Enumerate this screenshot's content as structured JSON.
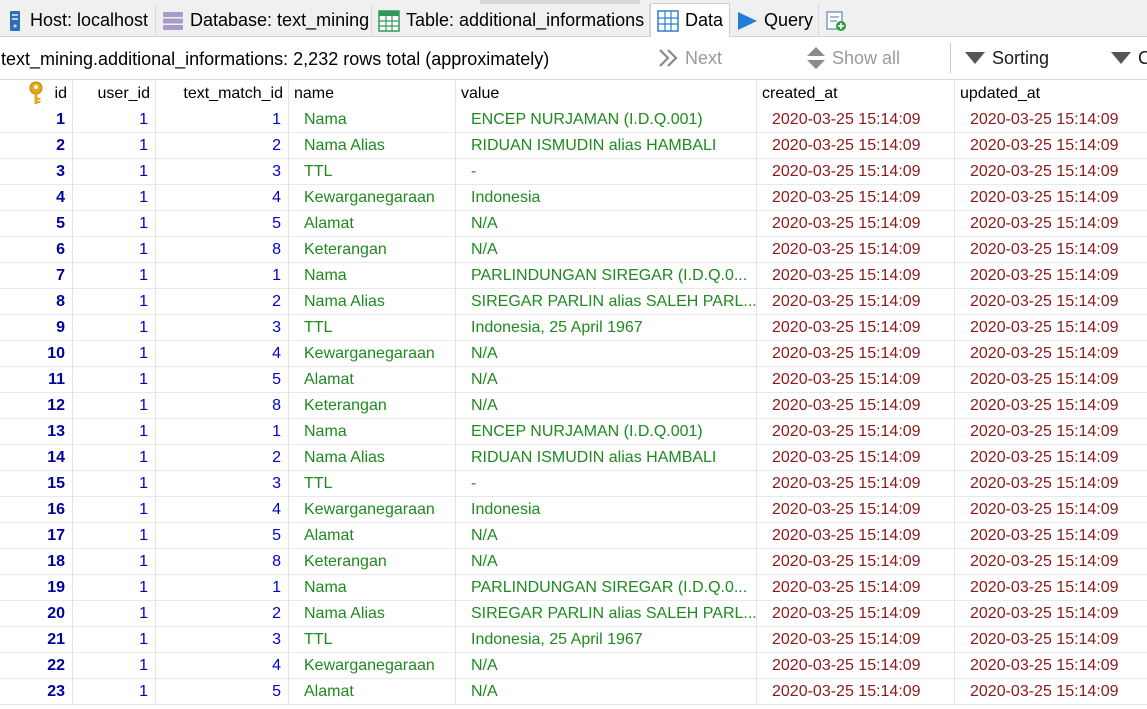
{
  "tabs": [
    {
      "label": "Host: localhost",
      "icon": "server-icon"
    },
    {
      "label": "Database: text_mining",
      "icon": "database-icon"
    },
    {
      "label": "Table: additional_informations",
      "icon": "table-icon"
    },
    {
      "label": "Data",
      "icon": "data-grid-icon",
      "active": true
    },
    {
      "label": "Query",
      "icon": "play-icon"
    },
    {
      "label": "",
      "icon": "new-query-icon"
    }
  ],
  "toolbar": {
    "status": "text_mining.additional_informations: 2,232 rows total (approximately)",
    "next_label": "Next",
    "show_all_label": "Show all",
    "sorting_label": "Sorting",
    "filter_label": "C"
  },
  "columns": [
    "id",
    "user_id",
    "text_match_id",
    "name",
    "value",
    "created_at",
    "updated_at"
  ],
  "primary_key_icon": "key-icon",
  "rows": [
    {
      "id": "1",
      "user_id": "1",
      "text_match_id": "1",
      "name": "Nama",
      "value": "ENCEP NURJAMAN (I.D.Q.001)",
      "created_at": "2020-03-25 15:14:09",
      "updated_at": "2020-03-25 15:14:09"
    },
    {
      "id": "2",
      "user_id": "1",
      "text_match_id": "2",
      "name": "Nama Alias",
      "value": "RIDUAN ISMUDIN alias HAMBALI",
      "created_at": "2020-03-25 15:14:09",
      "updated_at": "2020-03-25 15:14:09"
    },
    {
      "id": "3",
      "user_id": "1",
      "text_match_id": "3",
      "name": "TTL",
      "value": "-",
      "created_at": "2020-03-25 15:14:09",
      "updated_at": "2020-03-25 15:14:09"
    },
    {
      "id": "4",
      "user_id": "1",
      "text_match_id": "4",
      "name": "Kewarganegaraan",
      "value": "Indonesia",
      "created_at": "2020-03-25 15:14:09",
      "updated_at": "2020-03-25 15:14:09"
    },
    {
      "id": "5",
      "user_id": "1",
      "text_match_id": "5",
      "name": "Alamat",
      "value": "N/A",
      "created_at": "2020-03-25 15:14:09",
      "updated_at": "2020-03-25 15:14:09"
    },
    {
      "id": "6",
      "user_id": "1",
      "text_match_id": "8",
      "name": "Keterangan",
      "value": "N/A",
      "created_at": "2020-03-25 15:14:09",
      "updated_at": "2020-03-25 15:14:09"
    },
    {
      "id": "7",
      "user_id": "1",
      "text_match_id": "1",
      "name": "Nama",
      "value": "PARLINDUNGAN SIREGAR (I.D.Q.0...",
      "created_at": "2020-03-25 15:14:09",
      "updated_at": "2020-03-25 15:14:09"
    },
    {
      "id": "8",
      "user_id": "1",
      "text_match_id": "2",
      "name": "Nama Alias",
      "value": "SIREGAR PARLIN alias SALEH PARL...",
      "created_at": "2020-03-25 15:14:09",
      "updated_at": "2020-03-25 15:14:09"
    },
    {
      "id": "9",
      "user_id": "1",
      "text_match_id": "3",
      "name": "TTL",
      "value": "Indonesia, 25 April 1967",
      "created_at": "2020-03-25 15:14:09",
      "updated_at": "2020-03-25 15:14:09"
    },
    {
      "id": "10",
      "user_id": "1",
      "text_match_id": "4",
      "name": "Kewarganegaraan",
      "value": "N/A",
      "created_at": "2020-03-25 15:14:09",
      "updated_at": "2020-03-25 15:14:09"
    },
    {
      "id": "11",
      "user_id": "1",
      "text_match_id": "5",
      "name": "Alamat",
      "value": "N/A",
      "created_at": "2020-03-25 15:14:09",
      "updated_at": "2020-03-25 15:14:09"
    },
    {
      "id": "12",
      "user_id": "1",
      "text_match_id": "8",
      "name": "Keterangan",
      "value": "N/A",
      "created_at": "2020-03-25 15:14:09",
      "updated_at": "2020-03-25 15:14:09"
    },
    {
      "id": "13",
      "user_id": "1",
      "text_match_id": "1",
      "name": "Nama",
      "value": "ENCEP NURJAMAN (I.D.Q.001)",
      "created_at": "2020-03-25 15:14:09",
      "updated_at": "2020-03-25 15:14:09"
    },
    {
      "id": "14",
      "user_id": "1",
      "text_match_id": "2",
      "name": "Nama Alias",
      "value": "RIDUAN ISMUDIN alias HAMBALI",
      "created_at": "2020-03-25 15:14:09",
      "updated_at": "2020-03-25 15:14:09"
    },
    {
      "id": "15",
      "user_id": "1",
      "text_match_id": "3",
      "name": "TTL",
      "value": "-",
      "created_at": "2020-03-25 15:14:09",
      "updated_at": "2020-03-25 15:14:09"
    },
    {
      "id": "16",
      "user_id": "1",
      "text_match_id": "4",
      "name": "Kewarganegaraan",
      "value": "Indonesia",
      "created_at": "2020-03-25 15:14:09",
      "updated_at": "2020-03-25 15:14:09"
    },
    {
      "id": "17",
      "user_id": "1",
      "text_match_id": "5",
      "name": "Alamat",
      "value": "N/A",
      "created_at": "2020-03-25 15:14:09",
      "updated_at": "2020-03-25 15:14:09"
    },
    {
      "id": "18",
      "user_id": "1",
      "text_match_id": "8",
      "name": "Keterangan",
      "value": "N/A",
      "created_at": "2020-03-25 15:14:09",
      "updated_at": "2020-03-25 15:14:09"
    },
    {
      "id": "19",
      "user_id": "1",
      "text_match_id": "1",
      "name": "Nama",
      "value": "PARLINDUNGAN SIREGAR (I.D.Q.0...",
      "created_at": "2020-03-25 15:14:09",
      "updated_at": "2020-03-25 15:14:09"
    },
    {
      "id": "20",
      "user_id": "1",
      "text_match_id": "2",
      "name": "Nama Alias",
      "value": "SIREGAR PARLIN alias SALEH PARL...",
      "created_at": "2020-03-25 15:14:09",
      "updated_at": "2020-03-25 15:14:09"
    },
    {
      "id": "21",
      "user_id": "1",
      "text_match_id": "3",
      "name": "TTL",
      "value": "Indonesia, 25 April 1967",
      "created_at": "2020-03-25 15:14:09",
      "updated_at": "2020-03-25 15:14:09"
    },
    {
      "id": "22",
      "user_id": "1",
      "text_match_id": "4",
      "name": "Kewarganegaraan",
      "value": "N/A",
      "created_at": "2020-03-25 15:14:09",
      "updated_at": "2020-03-25 15:14:09"
    },
    {
      "id": "23",
      "user_id": "1",
      "text_match_id": "5",
      "name": "Alamat",
      "value": "N/A",
      "created_at": "2020-03-25 15:14:09",
      "updated_at": "2020-03-25 15:14:09"
    }
  ]
}
